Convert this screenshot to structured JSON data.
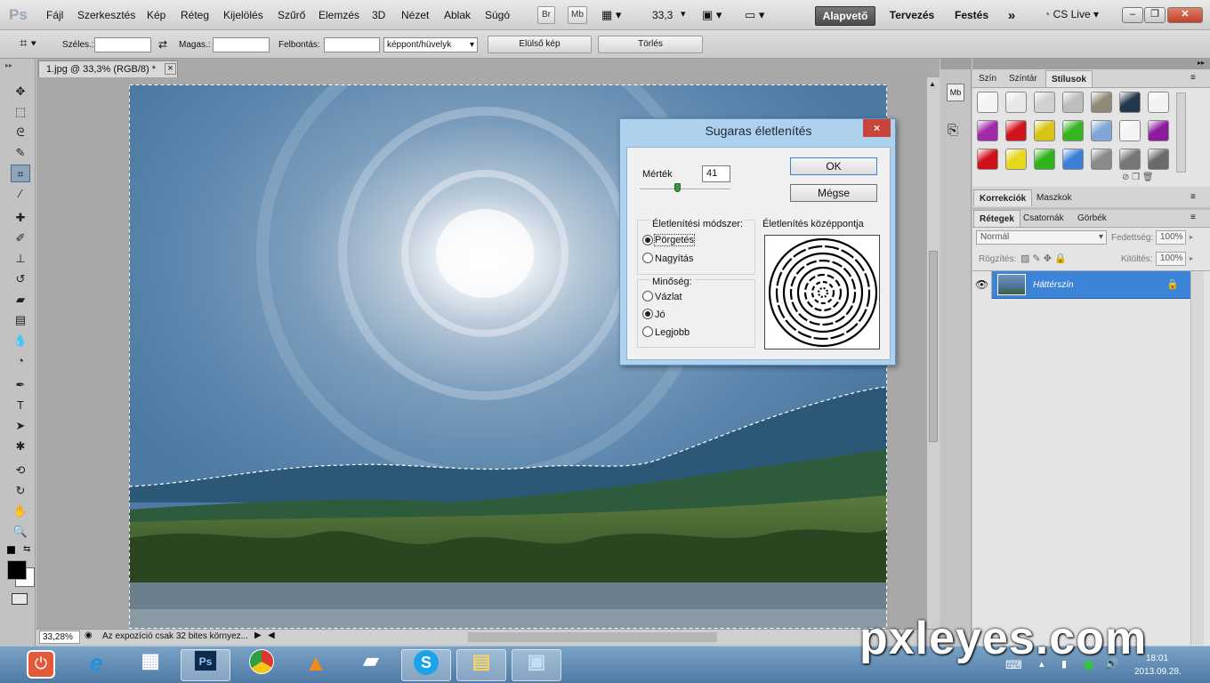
{
  "app": {
    "logo": "Ps"
  },
  "menu": [
    "Fájl",
    "Szerkesztés",
    "Kép",
    "Réteg",
    "Kijelölés",
    "Szűrő",
    "Elemzés",
    "3D",
    "Nézet",
    "Ablak",
    "Súgó"
  ],
  "appbar": {
    "br_label": "Br",
    "mb_label": "Mb",
    "zoom": "33,3"
  },
  "workspaces": {
    "active": "Alapvető",
    "items": [
      "Tervezés",
      "Festés"
    ],
    "more": "»"
  },
  "cs_live": "CS Live",
  "options": {
    "width_label": "Széles.:",
    "height_label": "Magas.:",
    "resolution_label": "Felbontás:",
    "unit_select": "képpont/hüvelyk",
    "front_image_button": "Elülső kép",
    "clear_button": "Törlés"
  },
  "document": {
    "tab_title": "1.jpg @ 33,3% (RGB/8) *",
    "tab_close": "×"
  },
  "status": {
    "zoom": "33,28%",
    "info": "Az expozíció csak 32 bites környez..."
  },
  "dialog": {
    "title": "Sugaras életlenítés",
    "close": "×",
    "amount_label": "Mérték",
    "amount_value": "41",
    "amount_fraction": 0.41,
    "ok_button": "OK",
    "cancel_button": "Mégse",
    "method_label": "Életlenítési módszer:",
    "method_spin": "Pörgetés",
    "method_zoom": "Nagyítás",
    "quality_label": "Minőség:",
    "quality_draft": "Vázlat",
    "quality_good": "Jó",
    "quality_best": "Legjobb",
    "center_label": "Életlenítés középpontja"
  },
  "panels": {
    "color_tabs": [
      "Szín",
      "Színtár",
      "Stílusok"
    ],
    "adjust_tabs": [
      "Korrekciók",
      "Maszkok"
    ],
    "layer_tabs": [
      "Rétegek",
      "Csatornák",
      "Görbék"
    ],
    "blend_mode": "Normál",
    "opacity_label": "Fedettség:",
    "opacity_value": "100%",
    "lock_label": "Rögzítés:",
    "fill_label": "Kitöltés:",
    "fill_value": "100%",
    "layer_name": "Háttérszín"
  },
  "styles_colors": [
    "#f4f4f4",
    "#e8e8e8",
    "#d0d0d0",
    "#bdbdbd",
    "#8f8a78",
    "#23384c",
    "#f2f2f2",
    "#a12aa8",
    "#d0141e",
    "#d9c316",
    "#35b424",
    "#7fa6d6",
    "#f4f4f4",
    "#8e1aa0",
    "#d0101a",
    "#e7d81e",
    "#2fb21c",
    "#3c7fd6",
    "#8a8a8a",
    "#777777",
    "#6a6a6a"
  ],
  "taskbar": {
    "ps_label": "Ps",
    "clock_time": "18:01",
    "clock_date": "2013.09.28."
  },
  "watermark": "pxleyes.com"
}
